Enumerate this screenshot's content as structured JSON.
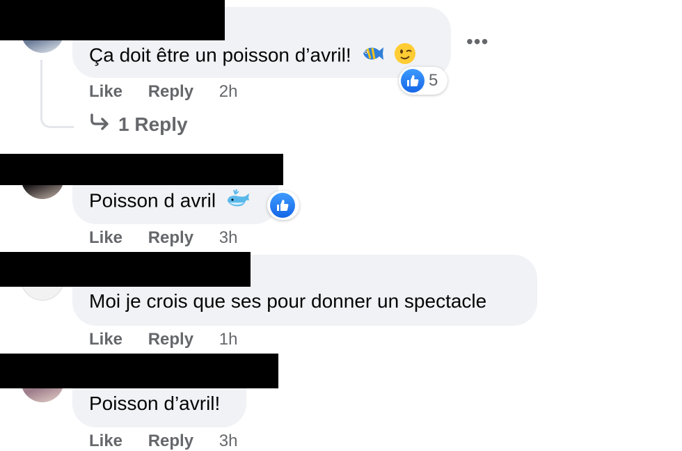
{
  "actions": {
    "like": "Like",
    "reply": "Reply"
  },
  "more_options_glyph": "•••",
  "comments": [
    {
      "text": "Ça doit être un poisson d’avril!",
      "emojis": [
        "tropical-fish",
        "winking-face"
      ],
      "time": "2h",
      "reaction_icon": "like-icon",
      "reaction_count": "5",
      "replies_link": "1 Reply"
    },
    {
      "text": "Poisson d avril",
      "emojis": [
        "spouting-whale"
      ],
      "time": "3h",
      "reaction_icon": "like-icon"
    },
    {
      "text": "Moi je crois que ses pour donner un spectacle",
      "time": "1h"
    },
    {
      "text": "Poisson d’avril!",
      "time": "3h"
    }
  ],
  "colors": {
    "bubble": "#f0f2f5",
    "meta_text": "#65676b",
    "like_blue": "#1877f2",
    "redaction": "#000000"
  }
}
